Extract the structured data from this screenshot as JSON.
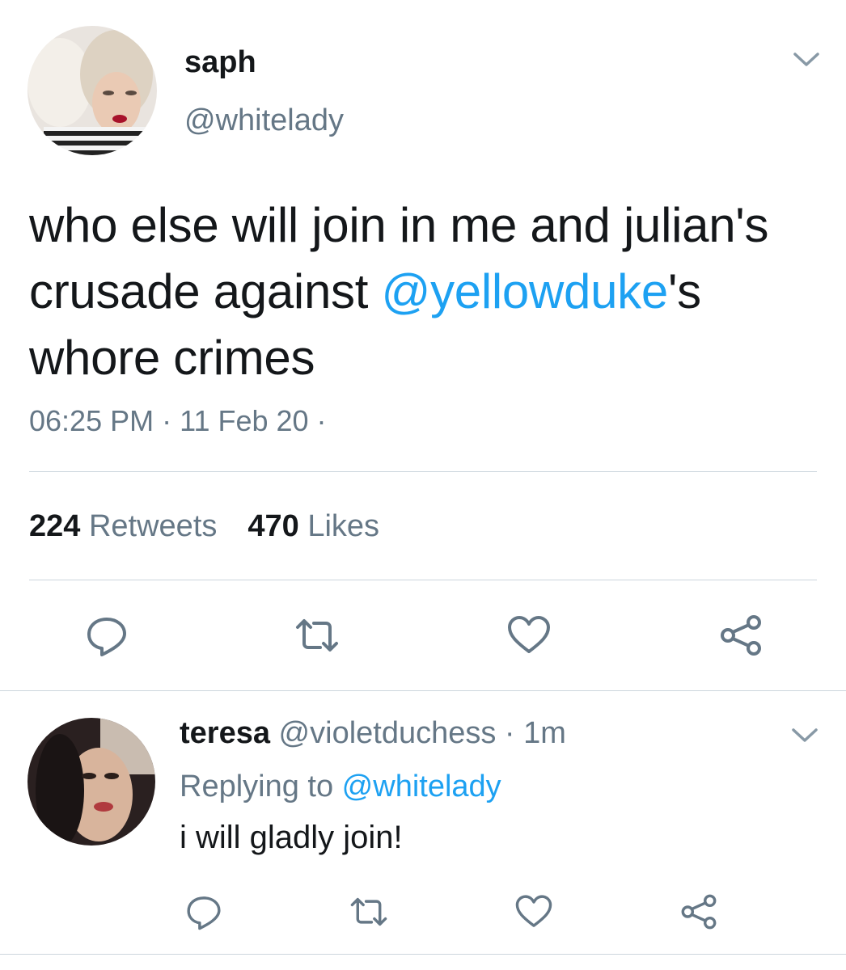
{
  "main_tweet": {
    "display_name": "saph",
    "handle": "@whitelady",
    "text_part1": "who else will join in me and julian's crusade against ",
    "mention": "@yellowduke",
    "text_part2": "'s whore crimes",
    "time": "06:25 PM",
    "separator": " · ",
    "date": "11 Feb 20",
    "trailing_dot": " ·",
    "retweet_count": "224",
    "retweet_label": "Retweets",
    "like_count": "470",
    "like_label": "Likes",
    "actions": [
      "reply-icon",
      "retweet-icon",
      "like-icon",
      "share-icon"
    ]
  },
  "reply_tweet": {
    "display_name": "teresa",
    "handle": "@violetduchess",
    "separator": " · ",
    "age": "1m",
    "replying_label": "Replying to ",
    "replying_to": "@whitelady",
    "text": "i will gladly join!",
    "actions": [
      "reply-icon",
      "retweet-icon",
      "like-icon",
      "share-icon"
    ]
  },
  "colors": {
    "text": "#14171a",
    "secondary": "#657786",
    "link": "#1da1f2",
    "divider": "#ccd6dd"
  }
}
